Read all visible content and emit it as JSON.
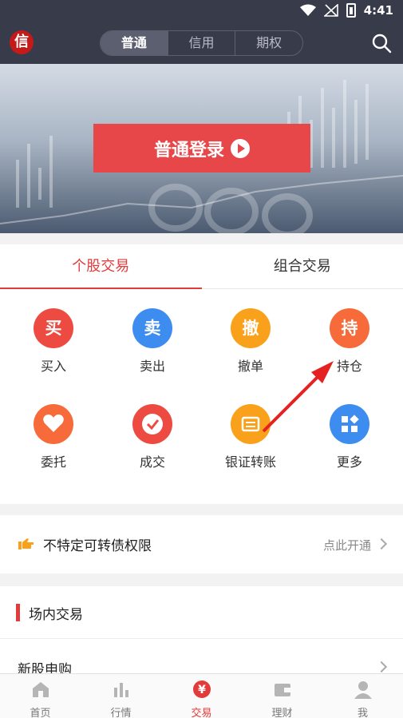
{
  "status_bar": {
    "time": "4:41",
    "icons": [
      "wifi-icon",
      "no-signal-icon",
      "battery-charging-icon"
    ]
  },
  "header": {
    "logo_text": "信",
    "segments": [
      {
        "label": "普通",
        "active": true
      },
      {
        "label": "信用",
        "active": false
      },
      {
        "label": "期权",
        "active": false
      }
    ],
    "search_icon": "search-icon"
  },
  "banner": {
    "login_label": "普通登录",
    "login_icon": "play-circle-icon"
  },
  "trade": {
    "tabs": [
      {
        "label": "个股交易",
        "active": true
      },
      {
        "label": "组合交易",
        "active": false
      }
    ],
    "actions": [
      {
        "label": "买入",
        "glyph": "买",
        "icon": "buy-icon",
        "color": "#ed4b41"
      },
      {
        "label": "卖出",
        "glyph": "卖",
        "icon": "sell-icon",
        "color": "#3d8cf0"
      },
      {
        "label": "撤单",
        "glyph": "撤",
        "icon": "cancel-order-icon",
        "color": "#f9a11a"
      },
      {
        "label": "持仓",
        "glyph": "持",
        "icon": "holdings-icon",
        "color": "#f76a3a"
      },
      {
        "label": "委托",
        "glyph": "",
        "icon": "heart-icon",
        "color": "#f76a3a"
      },
      {
        "label": "成交",
        "glyph": "",
        "icon": "check-icon",
        "color": "#ed4b41"
      },
      {
        "label": "银证转账",
        "glyph": "",
        "icon": "bank-transfer-icon",
        "color": "#f9a11a"
      },
      {
        "label": "更多",
        "glyph": "",
        "icon": "more-grid-icon",
        "color": "#3d8cf0"
      }
    ]
  },
  "convertible": {
    "title": "不特定可转债权限",
    "link": "点此开通"
  },
  "venue": {
    "title": "场内交易",
    "ipo": "新股申购"
  },
  "tabbar": [
    {
      "label": "首页",
      "icon": "home-icon",
      "active": false
    },
    {
      "label": "行情",
      "icon": "market-chart-icon",
      "active": false
    },
    {
      "label": "交易",
      "icon": "yuan-icon",
      "active": true
    },
    {
      "label": "理财",
      "icon": "wallet-icon",
      "active": false
    },
    {
      "label": "我",
      "icon": "user-icon",
      "active": false
    }
  ],
  "colors": {
    "accent": "#e23b3b",
    "header_bg": "#383b4a",
    "login_button": "#e8474a"
  }
}
